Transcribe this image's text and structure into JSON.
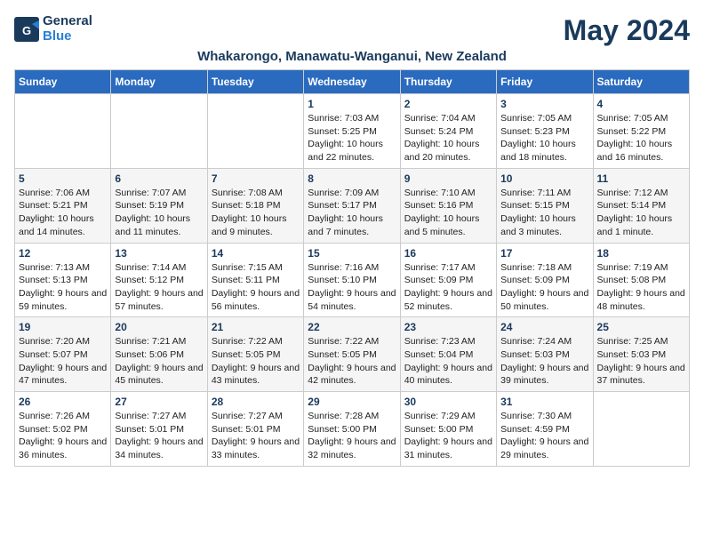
{
  "header": {
    "logo_text_general": "General",
    "logo_text_blue": "Blue",
    "month_title": "May 2024",
    "location": "Whakarongo, Manawatu-Wanganui, New Zealand"
  },
  "weekdays": [
    "Sunday",
    "Monday",
    "Tuesday",
    "Wednesday",
    "Thursday",
    "Friday",
    "Saturday"
  ],
  "weeks": [
    [
      {
        "day": "",
        "info": ""
      },
      {
        "day": "",
        "info": ""
      },
      {
        "day": "",
        "info": ""
      },
      {
        "day": "1",
        "info": "Sunrise: 7:03 AM\nSunset: 5:25 PM\nDaylight: 10 hours and 22 minutes."
      },
      {
        "day": "2",
        "info": "Sunrise: 7:04 AM\nSunset: 5:24 PM\nDaylight: 10 hours and 20 minutes."
      },
      {
        "day": "3",
        "info": "Sunrise: 7:05 AM\nSunset: 5:23 PM\nDaylight: 10 hours and 18 minutes."
      },
      {
        "day": "4",
        "info": "Sunrise: 7:05 AM\nSunset: 5:22 PM\nDaylight: 10 hours and 16 minutes."
      }
    ],
    [
      {
        "day": "5",
        "info": "Sunrise: 7:06 AM\nSunset: 5:21 PM\nDaylight: 10 hours and 14 minutes."
      },
      {
        "day": "6",
        "info": "Sunrise: 7:07 AM\nSunset: 5:19 PM\nDaylight: 10 hours and 11 minutes."
      },
      {
        "day": "7",
        "info": "Sunrise: 7:08 AM\nSunset: 5:18 PM\nDaylight: 10 hours and 9 minutes."
      },
      {
        "day": "8",
        "info": "Sunrise: 7:09 AM\nSunset: 5:17 PM\nDaylight: 10 hours and 7 minutes."
      },
      {
        "day": "9",
        "info": "Sunrise: 7:10 AM\nSunset: 5:16 PM\nDaylight: 10 hours and 5 minutes."
      },
      {
        "day": "10",
        "info": "Sunrise: 7:11 AM\nSunset: 5:15 PM\nDaylight: 10 hours and 3 minutes."
      },
      {
        "day": "11",
        "info": "Sunrise: 7:12 AM\nSunset: 5:14 PM\nDaylight: 10 hours and 1 minute."
      }
    ],
    [
      {
        "day": "12",
        "info": "Sunrise: 7:13 AM\nSunset: 5:13 PM\nDaylight: 9 hours and 59 minutes."
      },
      {
        "day": "13",
        "info": "Sunrise: 7:14 AM\nSunset: 5:12 PM\nDaylight: 9 hours and 57 minutes."
      },
      {
        "day": "14",
        "info": "Sunrise: 7:15 AM\nSunset: 5:11 PM\nDaylight: 9 hours and 56 minutes."
      },
      {
        "day": "15",
        "info": "Sunrise: 7:16 AM\nSunset: 5:10 PM\nDaylight: 9 hours and 54 minutes."
      },
      {
        "day": "16",
        "info": "Sunrise: 7:17 AM\nSunset: 5:09 PM\nDaylight: 9 hours and 52 minutes."
      },
      {
        "day": "17",
        "info": "Sunrise: 7:18 AM\nSunset: 5:09 PM\nDaylight: 9 hours and 50 minutes."
      },
      {
        "day": "18",
        "info": "Sunrise: 7:19 AM\nSunset: 5:08 PM\nDaylight: 9 hours and 48 minutes."
      }
    ],
    [
      {
        "day": "19",
        "info": "Sunrise: 7:20 AM\nSunset: 5:07 PM\nDaylight: 9 hours and 47 minutes."
      },
      {
        "day": "20",
        "info": "Sunrise: 7:21 AM\nSunset: 5:06 PM\nDaylight: 9 hours and 45 minutes."
      },
      {
        "day": "21",
        "info": "Sunrise: 7:22 AM\nSunset: 5:05 PM\nDaylight: 9 hours and 43 minutes."
      },
      {
        "day": "22",
        "info": "Sunrise: 7:22 AM\nSunset: 5:05 PM\nDaylight: 9 hours and 42 minutes."
      },
      {
        "day": "23",
        "info": "Sunrise: 7:23 AM\nSunset: 5:04 PM\nDaylight: 9 hours and 40 minutes."
      },
      {
        "day": "24",
        "info": "Sunrise: 7:24 AM\nSunset: 5:03 PM\nDaylight: 9 hours and 39 minutes."
      },
      {
        "day": "25",
        "info": "Sunrise: 7:25 AM\nSunset: 5:03 PM\nDaylight: 9 hours and 37 minutes."
      }
    ],
    [
      {
        "day": "26",
        "info": "Sunrise: 7:26 AM\nSunset: 5:02 PM\nDaylight: 9 hours and 36 minutes."
      },
      {
        "day": "27",
        "info": "Sunrise: 7:27 AM\nSunset: 5:01 PM\nDaylight: 9 hours and 34 minutes."
      },
      {
        "day": "28",
        "info": "Sunrise: 7:27 AM\nSunset: 5:01 PM\nDaylight: 9 hours and 33 minutes."
      },
      {
        "day": "29",
        "info": "Sunrise: 7:28 AM\nSunset: 5:00 PM\nDaylight: 9 hours and 32 minutes."
      },
      {
        "day": "30",
        "info": "Sunrise: 7:29 AM\nSunset: 5:00 PM\nDaylight: 9 hours and 31 minutes."
      },
      {
        "day": "31",
        "info": "Sunrise: 7:30 AM\nSunset: 4:59 PM\nDaylight: 9 hours and 29 minutes."
      },
      {
        "day": "",
        "info": ""
      }
    ]
  ]
}
